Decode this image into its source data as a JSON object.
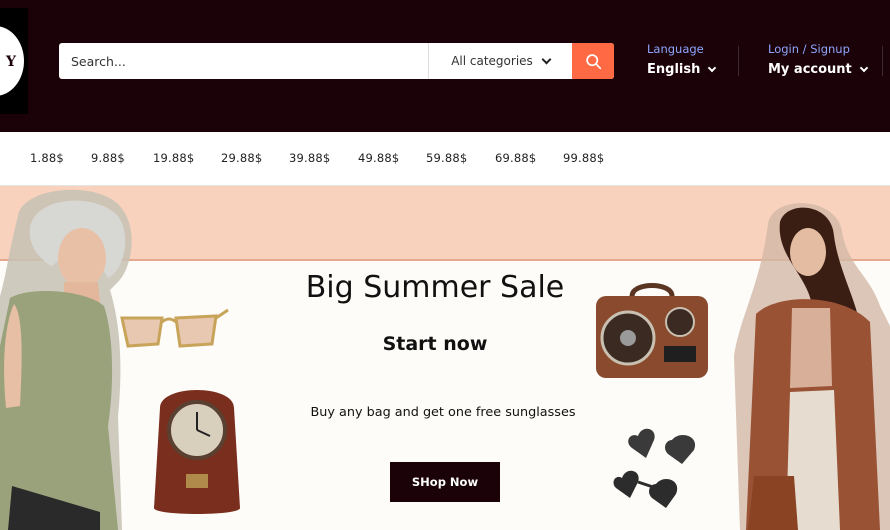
{
  "header": {
    "search": {
      "placeholder": "Search...",
      "category": "All categories"
    },
    "language": {
      "label": "Language",
      "value": "English"
    },
    "account": {
      "label": "Login / Signup",
      "value": "My account"
    },
    "icons": {
      "search": "search-icon",
      "chevron": "chevron-down-icon"
    }
  },
  "price_nav": {
    "items": [
      "1.88$",
      "9.88$",
      "19.88$",
      "29.88$",
      "39.88$",
      "49.88$",
      "59.88$",
      "69.88$",
      "99.88$"
    ]
  },
  "banner": {
    "title": "Big Summer Sale",
    "subtitle": "Start now",
    "tagline": "Buy any bag and get one free sunglasses",
    "cta": "SHop Now"
  },
  "colors": {
    "header_bg": "#1a0208",
    "accent": "#ff6a45",
    "link_blue": "#8fa6ff",
    "banner_peach": "#f8d2bd"
  }
}
